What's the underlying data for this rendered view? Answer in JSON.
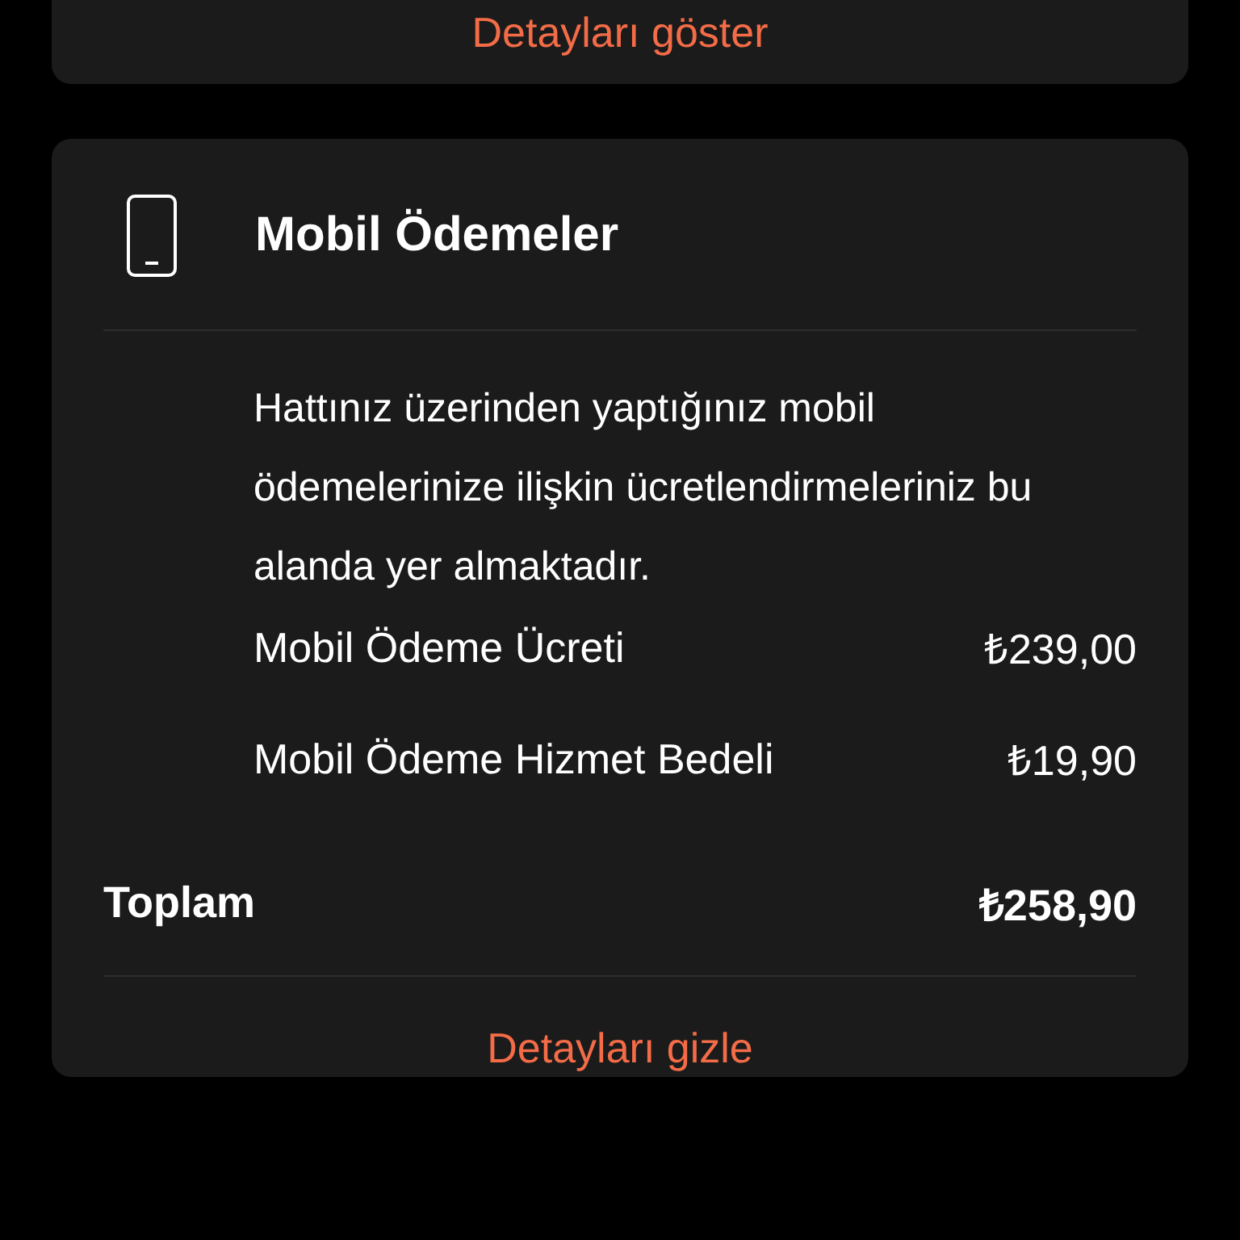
{
  "previous_card": {
    "toggle_label": "Detayları göster"
  },
  "card": {
    "title": "Mobil Ödemeler",
    "description": "Hattınız üzerinden yaptığınız mobil ödemelerinize ilişkin ücretlendirmeleriniz bu alanda yer almaktadır.",
    "items": [
      {
        "label": "Mobil Ödeme Ücreti",
        "amount": "₺239,00"
      },
      {
        "label": "Mobil Ödeme Hizmet Bedeli",
        "amount": "₺19,90"
      }
    ],
    "total": {
      "label": "Toplam",
      "amount": "₺258,90"
    },
    "toggle_label": "Detayları gizle"
  }
}
